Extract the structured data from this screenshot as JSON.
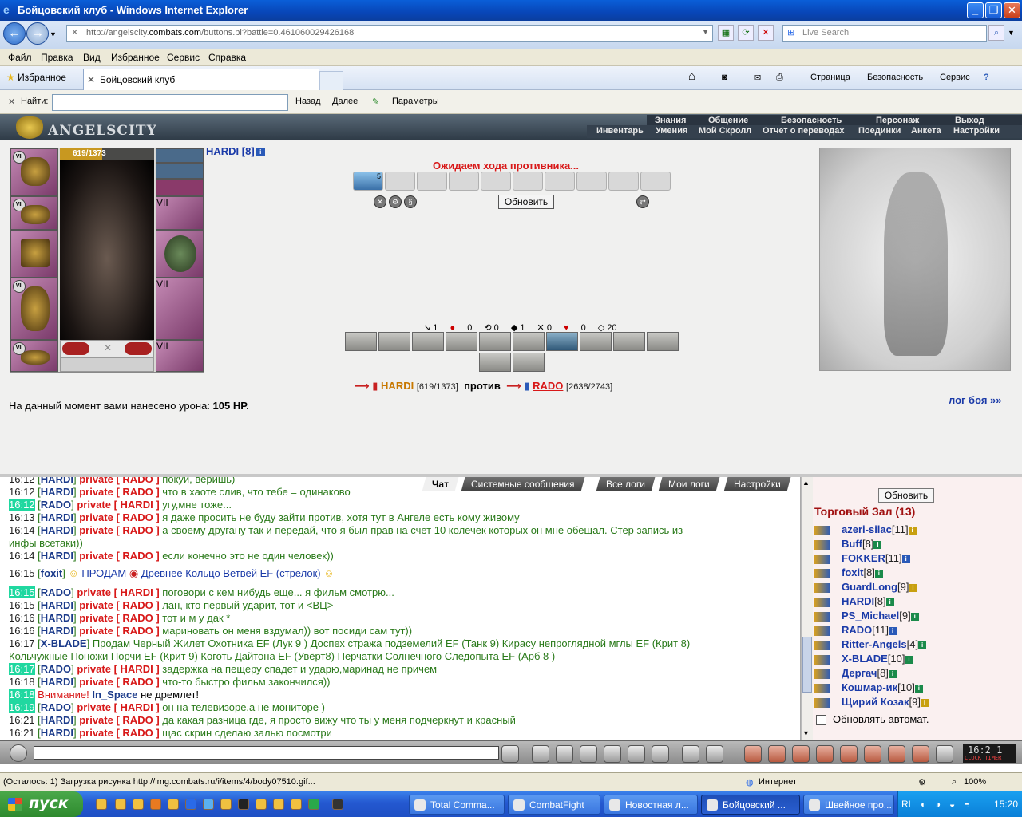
{
  "window": {
    "title": "Бойцовский клуб - Windows Internet Explorer"
  },
  "browser": {
    "url_prefix": "http://angelscity.",
    "url_host": "combats.com",
    "url_rest": "/buttons.pl?battle=0.461060029426168",
    "search_placeholder": "Live Search",
    "menu": [
      "Файл",
      "Правка",
      "Вид",
      "Избранное",
      "Сервис",
      "Справка"
    ],
    "favorites_label": "Избранное",
    "tab_title": "Бойцовский клуб",
    "toolbar_right": [
      "Страница",
      "Безопасность",
      "Сервис"
    ],
    "find_label": "Найти:",
    "find_back": "Назад",
    "find_next": "Далее",
    "find_params": "Параметры",
    "status_text": "(Осталось: 1) Загрузка рисунка http://img.combats.ru/i/items/4/body07510.gif...",
    "zone": "Интернет",
    "zoom": "100%"
  },
  "game": {
    "logo": "ANGELSCITY",
    "topmenu1": [
      "Знания",
      "Общение",
      "Безопасность",
      "Персонаж",
      "Выход"
    ],
    "topmenu2": [
      "Инвентарь",
      "Умения",
      "Мой Скролл",
      "Отчет о переводах",
      "Поединки",
      "Анкета",
      "Настройки"
    ],
    "player": {
      "name": "HARDI",
      "level": "[8]",
      "hp": "619/1373",
      "hp_fraction": 0.451
    },
    "slot_mark": "VII",
    "waiting": "Ожидаем хода противника...",
    "first_slot_count": "5",
    "refresh": "Обновить",
    "stats": [
      "1",
      "0",
      "0",
      "1",
      "0",
      "0",
      "20"
    ],
    "versus": {
      "p1": "HARDI",
      "p1hp": "[619/1373]",
      "vs": "против",
      "p2": "RADO",
      "p2hp": "[2638/2743]"
    },
    "damage_prefix": "На данный момент вами нанесено урона:",
    "damage_value": "105 HP.",
    "log_link": "лог боя »»"
  },
  "chat": {
    "tabs": [
      "Чат",
      "Системные сообщения",
      "Все логи",
      "Мои логи",
      "Настройки"
    ],
    "lines": [
      {
        "t": "16:12",
        "hl": false,
        "a": "HARDI",
        "b": "RADO",
        "msg": "покуй, веришь)"
      },
      {
        "t": "16:12",
        "hl": false,
        "a": "HARDI",
        "b": "RADO",
        "msg": "что в хаоте слив, что тебе = одинаково"
      },
      {
        "t": "16:12",
        "hl": true,
        "a": "RADO",
        "b": "HARDI",
        "msg": "угу,мне тоже..."
      },
      {
        "t": "16:13",
        "hl": false,
        "a": "HARDI",
        "b": "RADO",
        "msg": "я даже просить не буду зайти против, хотя тут в Ангеле есть кому живому"
      },
      {
        "t": "16:14",
        "hl": false,
        "a": "HARDI",
        "b": "RADO",
        "msg": "а своему другану так и передай, что я был прав на счет 10 колечек которых он мне обещал. Стер запись из"
      },
      {
        "cont": "инфы всетаки))"
      },
      {
        "t": "16:14",
        "hl": false,
        "a": "HARDI",
        "b": "RADO",
        "msg": "если конечно это не один человек))"
      },
      {
        "t": "16:15",
        "hl": false,
        "a": "foxit",
        "sale": "ПРОДАМ",
        "item": "Древнее Кольцо Ветвей EF (стрелок)"
      },
      {
        "t": "16:15",
        "hl": true,
        "a": "RADO",
        "b": "HARDI",
        "msg": "поговори с кем нибудь еще... я фильм смотрю..."
      },
      {
        "t": "16:15",
        "hl": false,
        "a": "HARDI",
        "b": "RADO",
        "msg": "лан, кто первый ударит, тот и <ВЦ>"
      },
      {
        "t": "16:16",
        "hl": false,
        "a": "HARDI",
        "b": "RADO",
        "msg": "тот и м у дак *"
      },
      {
        "t": "16:16",
        "hl": false,
        "a": "HARDI",
        "b": "RADO",
        "msg": "мариновать он меня вздумал)) вот посиди сам тут))"
      },
      {
        "t": "16:17",
        "hl": false,
        "a": "X-BLADE",
        "plain": "Продам Черный Жилет Охотника EF (Лук 9 ) Доспех стража подземелий EF (Танк 9) Кирасу непроглядной мглы EF (Крит 8)"
      },
      {
        "cont": "Кольчужные Поножи Порчи EF (Крит 9) Коготь Дайтона EF (Увёрт8) Перчатки Солнечного Следопыта EF (Арб 8 )"
      },
      {
        "t": "16:17",
        "hl": true,
        "a": "RADO",
        "b": "HARDI",
        "msg": "задержка на пещеру спадет и ударю,маринад не причем"
      },
      {
        "t": "16:18",
        "hl": false,
        "a": "HARDI",
        "b": "RADO",
        "msg": "что-то быстро фильм закончился))"
      },
      {
        "t": "16:18",
        "hl": true,
        "warn": "Внимание!",
        "who": "In_Space",
        "rest": "не дремлет!"
      },
      {
        "t": "16:19",
        "hl": true,
        "a": "RADO",
        "b": "HARDI",
        "msg": "он на телевизоре,а не мониторе )"
      },
      {
        "t": "16:21",
        "hl": false,
        "a": "HARDI",
        "b": "RADO",
        "msg": "да какая разница где, я просто вижу что ты у меня подчеркнут и красный"
      },
      {
        "t": "16:21",
        "hl": false,
        "a": "HARDI",
        "b": "RADO",
        "msg": "щас скрин сделаю залью посмотри"
      }
    ],
    "private_word": "private"
  },
  "online": {
    "refresh": "Обновить",
    "title": "Торговый Зал (13)",
    "users": [
      {
        "name": "azeri-silac",
        "lv": "[11]",
        "c": "y"
      },
      {
        "name": "Buff",
        "lv": "[8]",
        "c": ""
      },
      {
        "name": "FOKKER",
        "lv": "[11]",
        "c": "b"
      },
      {
        "name": "foxit",
        "lv": "[8]",
        "c": ""
      },
      {
        "name": "GuardLong",
        "lv": "[9]",
        "c": "y"
      },
      {
        "name": "HARDI",
        "lv": "[8]",
        "c": ""
      },
      {
        "name": "PS_Michael",
        "lv": "[9]",
        "c": ""
      },
      {
        "name": "RADO",
        "lv": "[11]",
        "c": "b"
      },
      {
        "name": "Ritter-Angels",
        "lv": "[4]",
        "c": ""
      },
      {
        "name": "X-BLADE",
        "lv": "[10]",
        "c": ""
      },
      {
        "name": "Дергач",
        "lv": "[8]",
        "c": ""
      },
      {
        "name": "Кошмар-ик",
        "lv": "[10]",
        "c": ""
      },
      {
        "name": "Щирий Козак",
        "lv": "[9]",
        "c": "y"
      }
    ],
    "auto": "Обновлять автомат."
  },
  "clock": {
    "time": "16:2 1",
    "label": "CLOCK TIMER"
  },
  "taskbar": {
    "start": "пуск",
    "tasks": [
      "Total Comma...",
      "CombatFight",
      "Новостная л...",
      "Бойцовский ...",
      "Швейное про..."
    ],
    "lang": "RL",
    "time": "15:20"
  },
  "colors": {
    "accent": "#d81818",
    "link": "#1a3aa8",
    "highlight": "#20d8a0"
  }
}
